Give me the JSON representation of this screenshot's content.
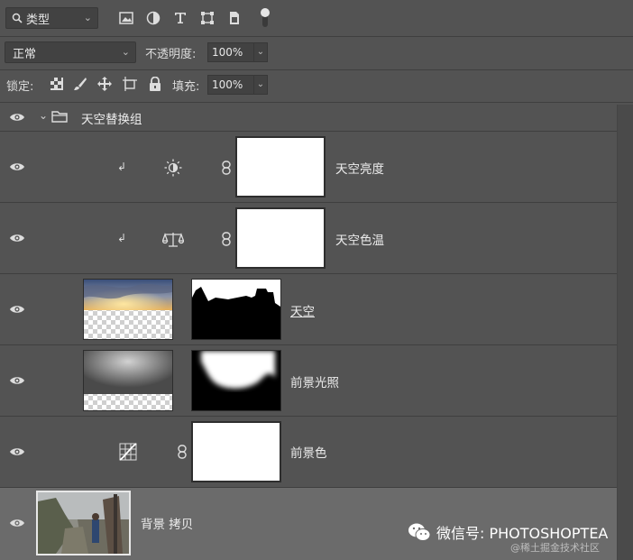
{
  "toolbar": {
    "filter_label": "类型",
    "blend_mode": "正常",
    "opacity_label": "不透明度:",
    "opacity_value": "100%",
    "lock_label": "锁定:",
    "fill_label": "填充:",
    "fill_value": "100%"
  },
  "layers": [
    {
      "name": "天空替换组",
      "type": "group"
    },
    {
      "name": "天空亮度",
      "type": "adjustment",
      "icon": "sun-icon"
    },
    {
      "name": "天空色温",
      "type": "adjustment",
      "icon": "balance-icon"
    },
    {
      "name": "天空",
      "type": "image"
    },
    {
      "name": "前景光照",
      "type": "image"
    },
    {
      "name": "前景色",
      "type": "adjustment",
      "icon": "curves-icon"
    },
    {
      "name": "背景 拷贝",
      "type": "image",
      "selected": true
    }
  ],
  "watermark": {
    "text": "微信号: PHOTOSHOPTEA",
    "sub": "@稀土掘金技术社区"
  }
}
